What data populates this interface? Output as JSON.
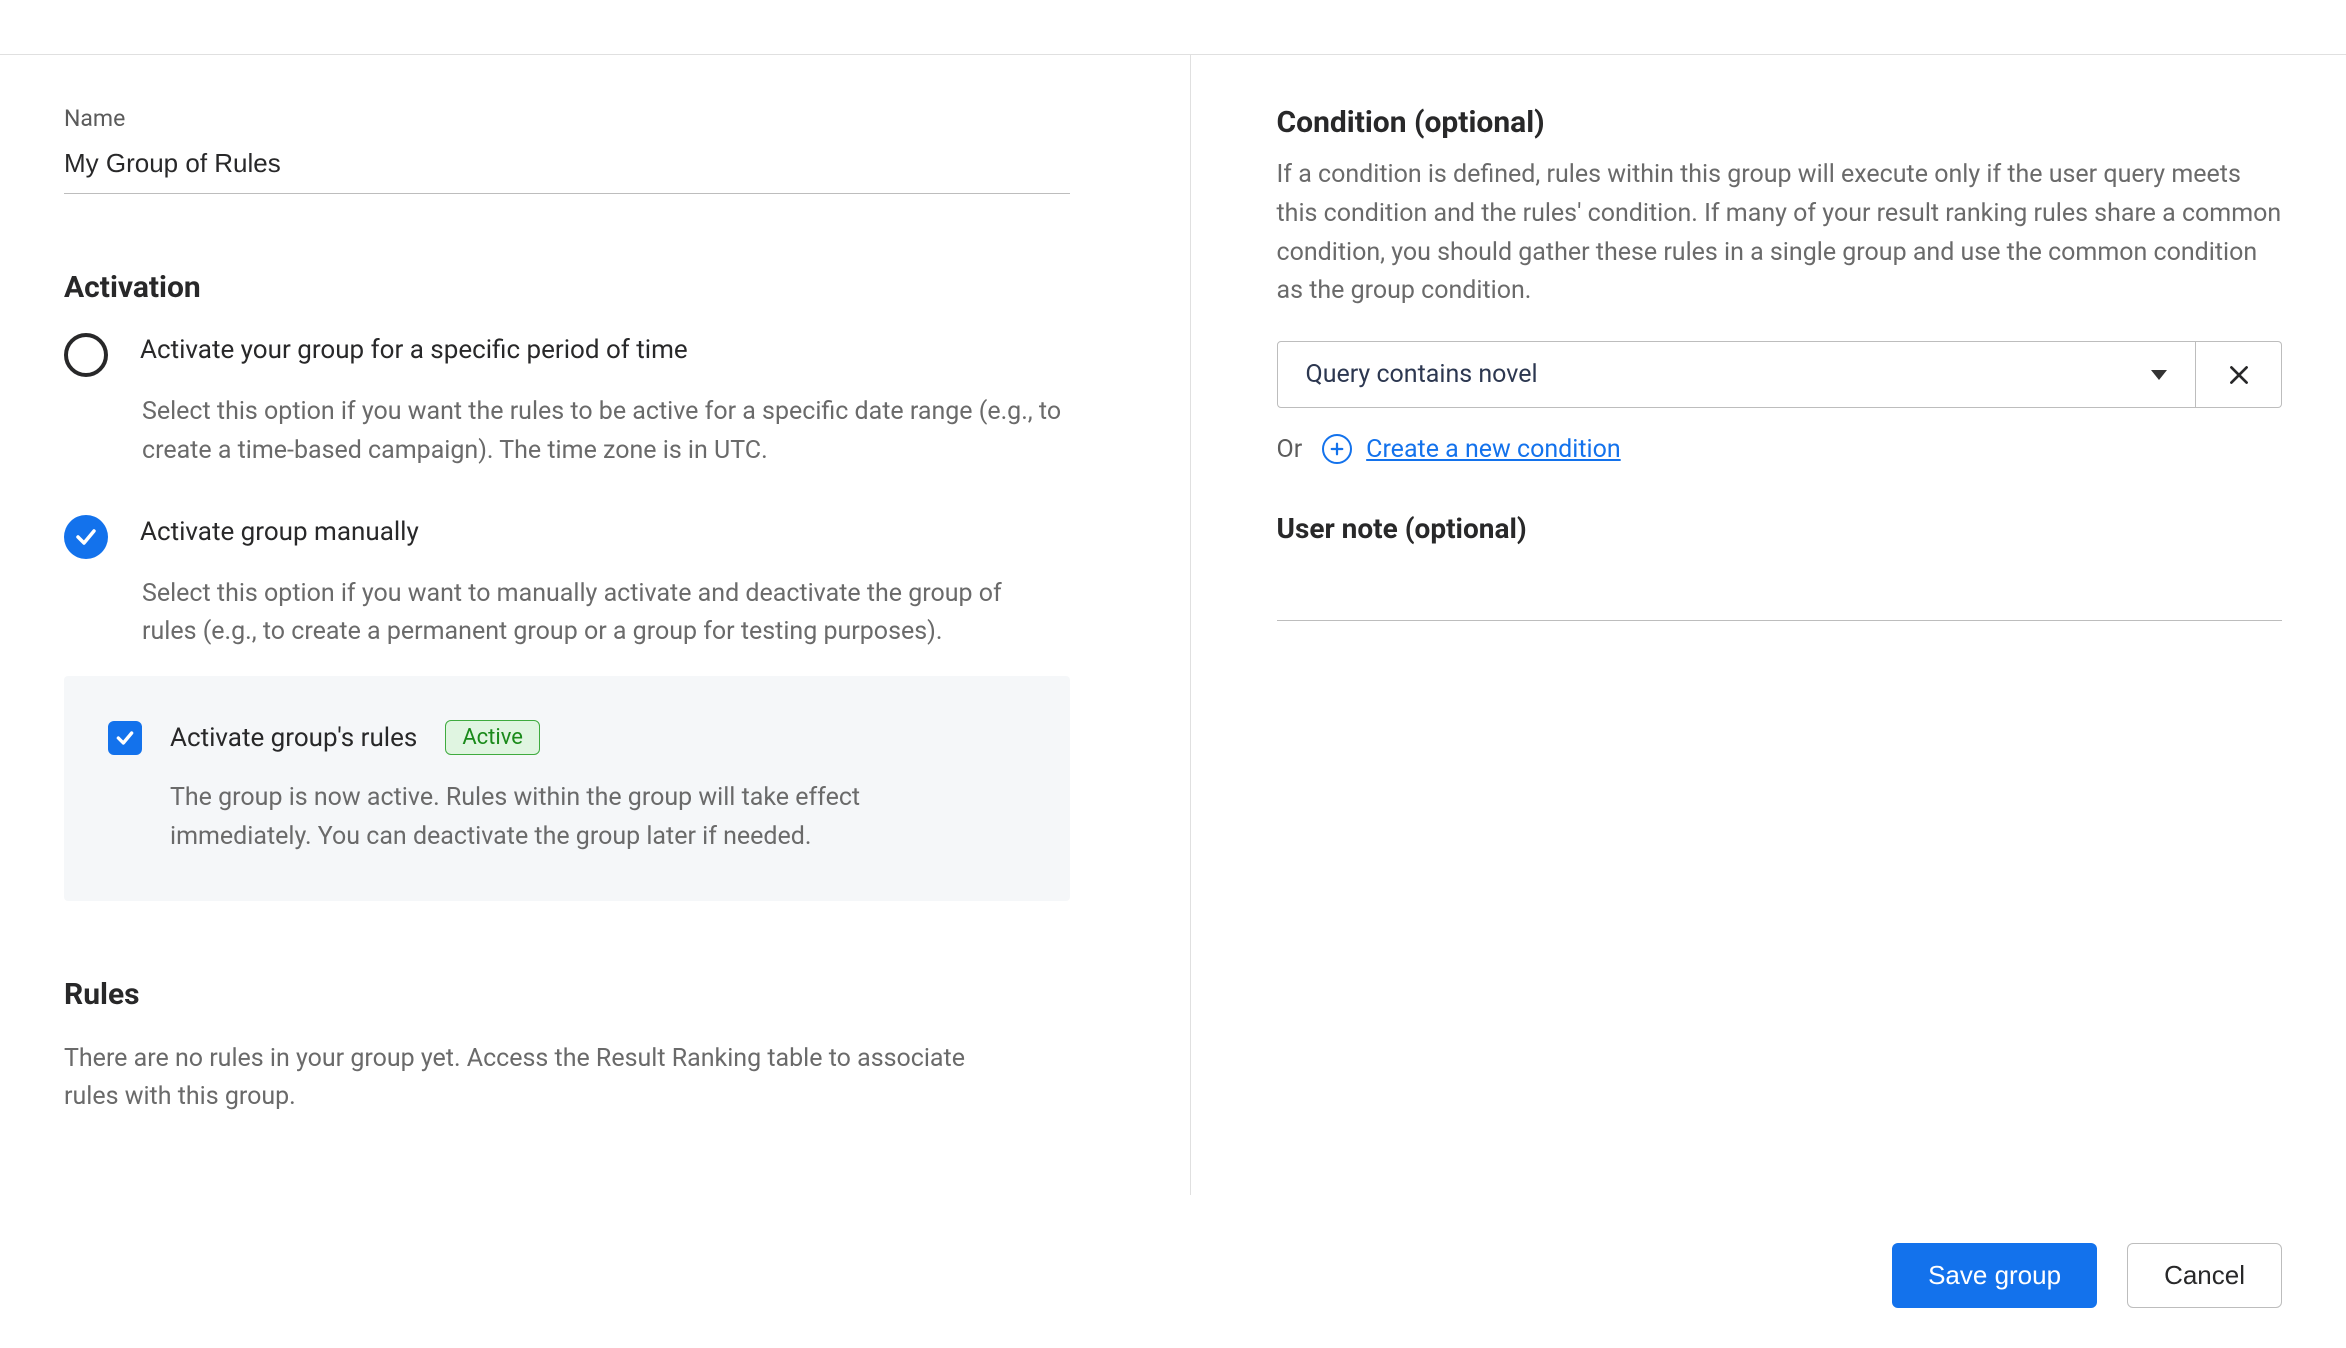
{
  "left": {
    "name_label": "Name",
    "name_value": "My Group of Rules",
    "activation_heading": "Activation",
    "option_time": {
      "label": "Activate your group for a specific period of time",
      "desc": "Select this option if you want the rules to be active for a specific date range (e.g., to create a time-based campaign). The time zone is in UTC."
    },
    "option_manual": {
      "label": "Activate group manually",
      "desc": "Select this option if you want to manually activate and deactivate the group of rules (e.g., to create a permanent group or a group for testing purposes)."
    },
    "sub_checkbox": {
      "label": "Activate group's rules",
      "badge": "Active",
      "desc": "The group is now active. Rules within the group will take effect immediately. You can deactivate the group later if needed."
    },
    "rules_heading": "Rules",
    "rules_empty": "There are no rules in your group yet. Access the Result Ranking table to associate rules with this group."
  },
  "right": {
    "condition_heading": "Condition (optional)",
    "condition_desc": "If a condition is defined, rules within this group will execute only if the user query meets this condition and the rules' condition. If many of your result ranking rules share a common condition, you should gather these rules in a single group and use the common condition as the group condition.",
    "condition_selected": "Query contains novel",
    "or_label": "Or",
    "create_condition_link": "Create a new condition",
    "user_note_heading": "User note (optional)",
    "user_note_value": ""
  },
  "footer": {
    "save": "Save group",
    "cancel": "Cancel"
  }
}
